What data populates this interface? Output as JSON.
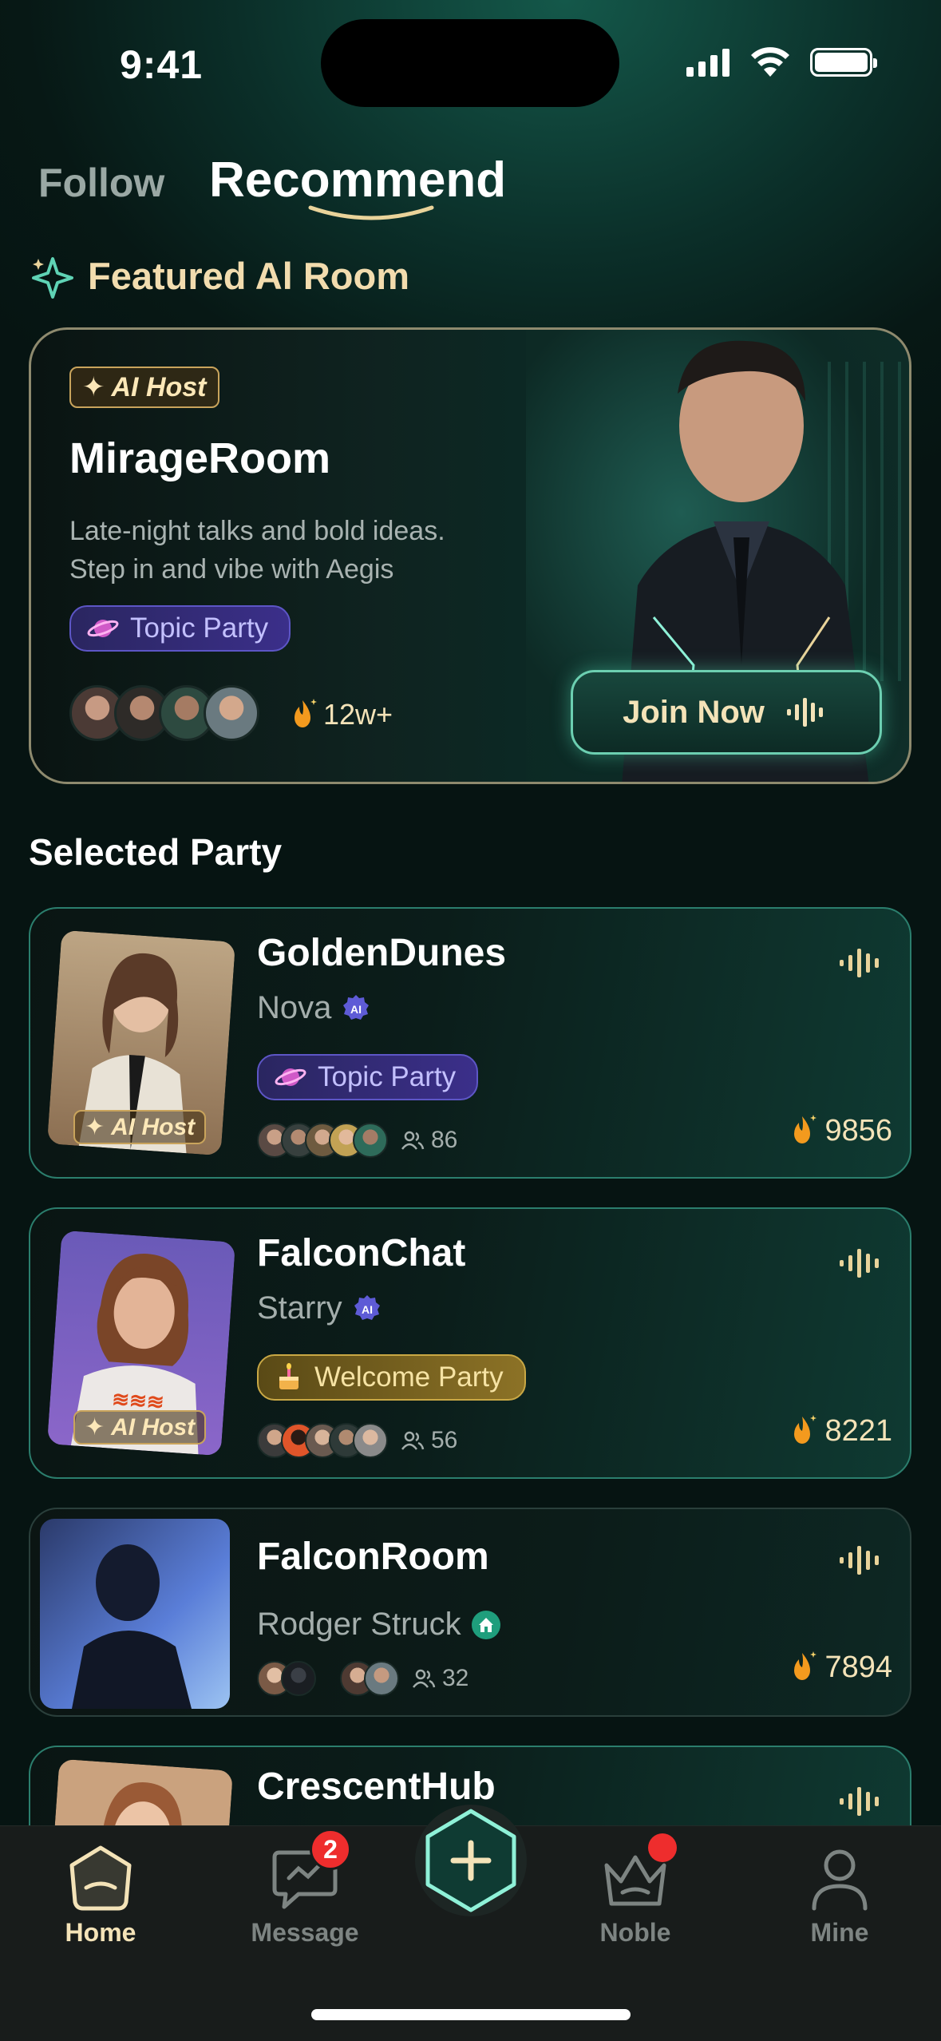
{
  "status_bar": {
    "time": "9:41"
  },
  "tabs": {
    "follow": "Follow",
    "recommend": "Recommend"
  },
  "featured": {
    "header": "Featured Al Room",
    "badge": "AI Host",
    "title": "MirageRoom",
    "description_line1": "Late-night talks and bold ideas.",
    "description_line2": "Step in and vibe with Aegis",
    "chip": "Topic Party",
    "heat": "12w+",
    "join_label": "Join Now"
  },
  "selected_party": {
    "title": "Selected Party",
    "rooms": [
      {
        "name": "GoldenDunes",
        "host": "Nova",
        "chip": "Topic Party",
        "members": "86",
        "heat": "9856",
        "badge": "AI Host"
      },
      {
        "name": "FalconChat",
        "host": "Starry",
        "chip": "Welcome Party",
        "members": "56",
        "heat": "8221",
        "badge": "AI Host"
      },
      {
        "name": "FalconRoom",
        "host": "Rodger Struck",
        "members": "32",
        "heat": "7894"
      },
      {
        "name": "CrescentHub"
      }
    ]
  },
  "tabbar": {
    "home": "Home",
    "message": "Message",
    "message_badge": "2",
    "noble": "Noble",
    "mine": "Mine"
  },
  "colors": {
    "accent_gold": "#f4e3b8",
    "accent_teal": "#6ccfb1",
    "badge_red": "#ee2d2d"
  }
}
